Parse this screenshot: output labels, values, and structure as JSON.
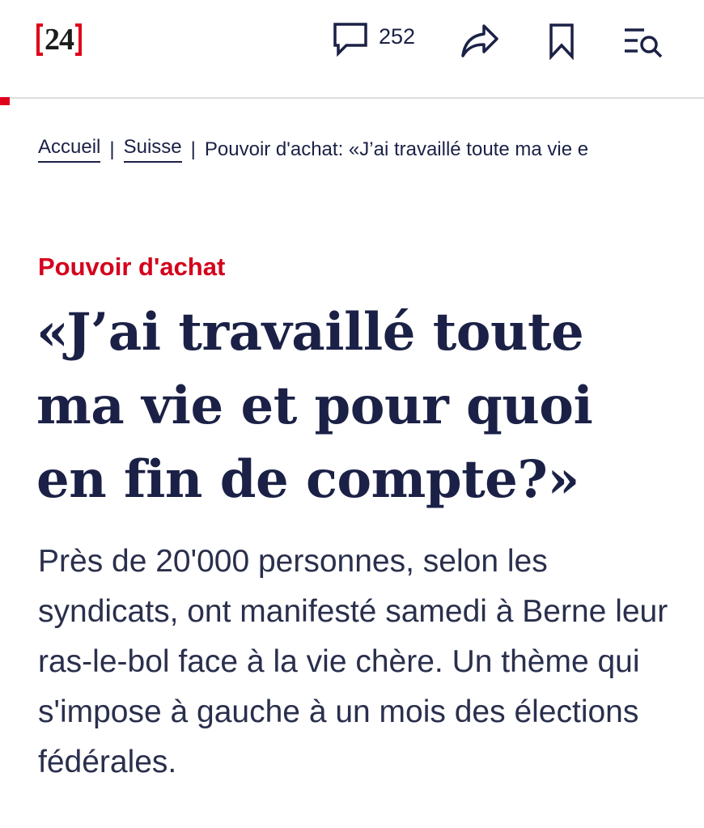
{
  "header": {
    "logo_text": "24",
    "comment_count": "252",
    "icons": [
      "comment-icon",
      "share-icon",
      "bookmark-icon",
      "menu-search-icon"
    ]
  },
  "breadcrumb": {
    "items": [
      "Accueil",
      "Suisse"
    ],
    "separator": "|",
    "current": "Pouvoir d'achat: «J’ai travaillé toute ma vie e"
  },
  "article": {
    "kicker": "Pouvoir d'achat",
    "title": "«J’ai travaillé toute ma vie et pour quoi en fin de compte?»",
    "lead": "Près de 20'000 personnes, selon les syndicats, ont manifesté samedi à Berne leur ras-le-bol face à la vie chère. Un thème qui s'impose à gauche à un mois des élections fédérales."
  },
  "colors": {
    "brand_red": "#e0001a",
    "navy": "#1b2146"
  }
}
